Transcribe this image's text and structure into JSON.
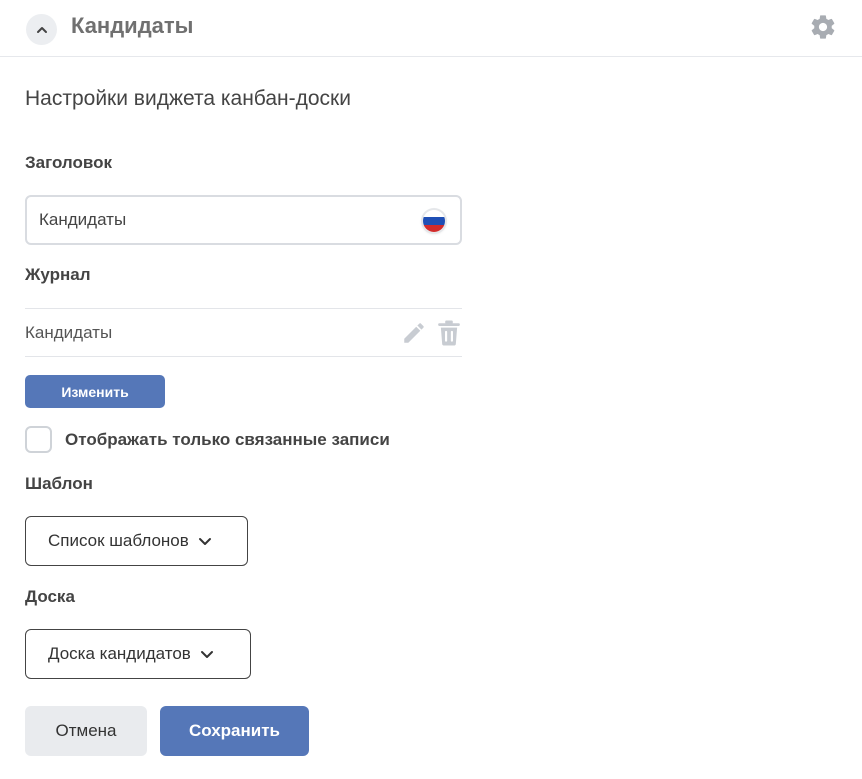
{
  "header": {
    "title": "Кандидаты",
    "collapse_icon": "chevron-up-icon",
    "settings_icon": "gear-icon"
  },
  "settings": {
    "section_title": "Настройки виджета канбан-доски",
    "title_field": {
      "label": "Заголовок",
      "value": "Кандидаты",
      "language_icon": "russian-flag-icon"
    },
    "journal": {
      "label": "Журнал",
      "value": "Кандидаты",
      "edit_icon": "pencil-icon",
      "delete_icon": "trash-icon",
      "change_label": "Изменить"
    },
    "linked_only": {
      "label": "Отображать только связанные записи",
      "checked": false
    },
    "template": {
      "label": "Шаблон",
      "selected": "Список шаблонов"
    },
    "board": {
      "label": "Доска",
      "selected": "Доска кандидатов"
    }
  },
  "footer": {
    "cancel_label": "Отмена",
    "save_label": "Сохранить"
  },
  "colors": {
    "primary": "#5577b8",
    "secondary_button": "#e9ebee",
    "icon_gray": "#c8ccd2",
    "flag_white": "#ffffff",
    "flag_blue": "#1f4fb5",
    "flag_red": "#d22b2b"
  }
}
